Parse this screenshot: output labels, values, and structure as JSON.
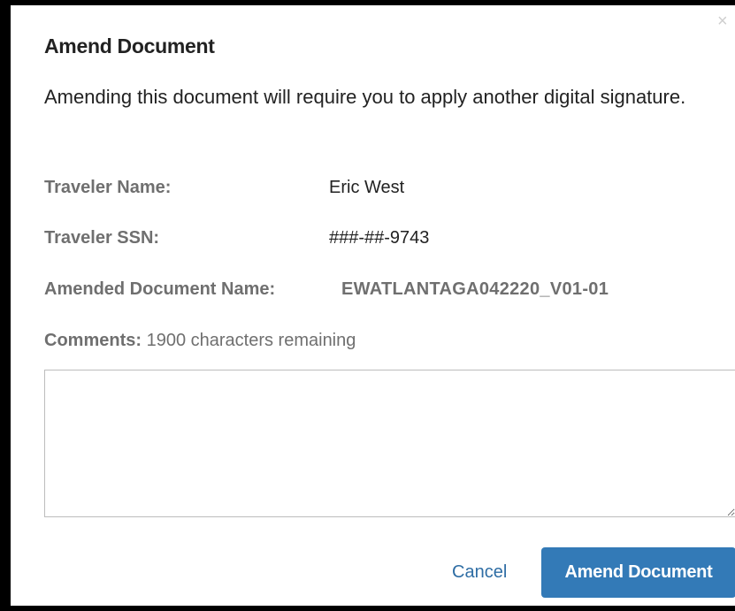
{
  "dialog": {
    "title": "Amend Document",
    "close_glyph": "×",
    "message": "Amending this document will require you to apply another digital signature."
  },
  "fields": {
    "traveler_name_label": "Traveler Name:",
    "traveler_name_value": "Eric West",
    "traveler_ssn_label": "Traveler SSN:",
    "traveler_ssn_value": "###-##-9743",
    "doc_name_label": "Amended Document Name:",
    "doc_name_value": "EWATLANTAGA042220_V01-01"
  },
  "comments": {
    "label": "Comments:",
    "remaining": "1900 characters remaining",
    "value": ""
  },
  "footer": {
    "cancel_label": "Cancel",
    "amend_label": "Amend Document"
  },
  "colors": {
    "primary_button": "#337ab7",
    "link": "#2e6da4",
    "muted_label": "#6f6f6f"
  }
}
